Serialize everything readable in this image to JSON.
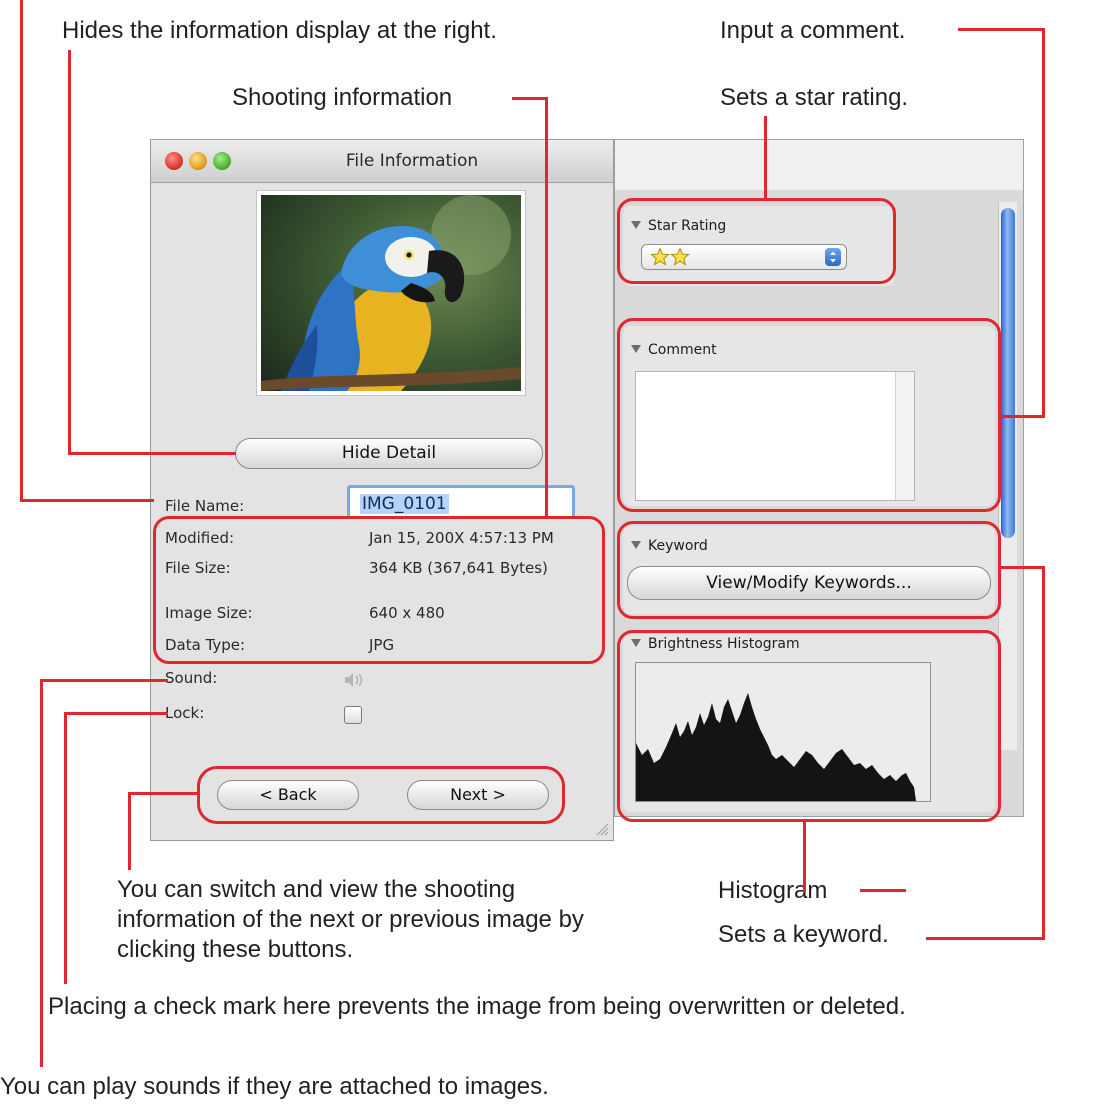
{
  "window": {
    "title": "File Information",
    "hide_detail_label": "Hide Detail",
    "fields": {
      "file_name_label": "File Name:",
      "file_name_value": "IMG_0101",
      "modified_label": "Modified:",
      "modified_value": "Jan 15, 200X 4:57:13 PM",
      "file_size_label": "File Size:",
      "file_size_value": "364 KB (367,641 Bytes)",
      "image_size_label": "Image Size:",
      "image_size_value": "640 x 480",
      "data_type_label": "Data Type:",
      "data_type_value": "JPG",
      "sound_label": "Sound:",
      "lock_label": "Lock:"
    },
    "lock_checked": false,
    "back_label": "< Back",
    "next_label": "Next >"
  },
  "panel": {
    "star_rating_title": "Star Rating",
    "star_rating_value": 2,
    "comment_title": "Comment",
    "comment_text": "",
    "keyword_title": "Keyword",
    "keyword_button": "View/Modify Keywords...",
    "histogram_title": "Brightness Histogram"
  },
  "callouts": {
    "hide_info": "Hides the information display at the right.",
    "shooting_info": "Shooting information",
    "input_comment": "Input a comment.",
    "star_rating": "Sets a star rating.",
    "switch_view": "You can switch and view the shooting information of the next or previous image by clicking these buttons.",
    "histogram": "Histogram",
    "keyword": "Sets a keyword.",
    "lock": "Placing a check mark here prevents the image from being overwritten or deleted.",
    "sound": "You can play sounds if they are attached to images."
  },
  "colors": {
    "annotation_red": "#e0262f",
    "scrollbar_blue": "#3f79d6"
  },
  "icons": [
    "close-window-icon",
    "minimize-window-icon",
    "zoom-window-icon",
    "speaker-icon",
    "star-icon",
    "stepper-icon",
    "disclosure-triangle-icon"
  ]
}
